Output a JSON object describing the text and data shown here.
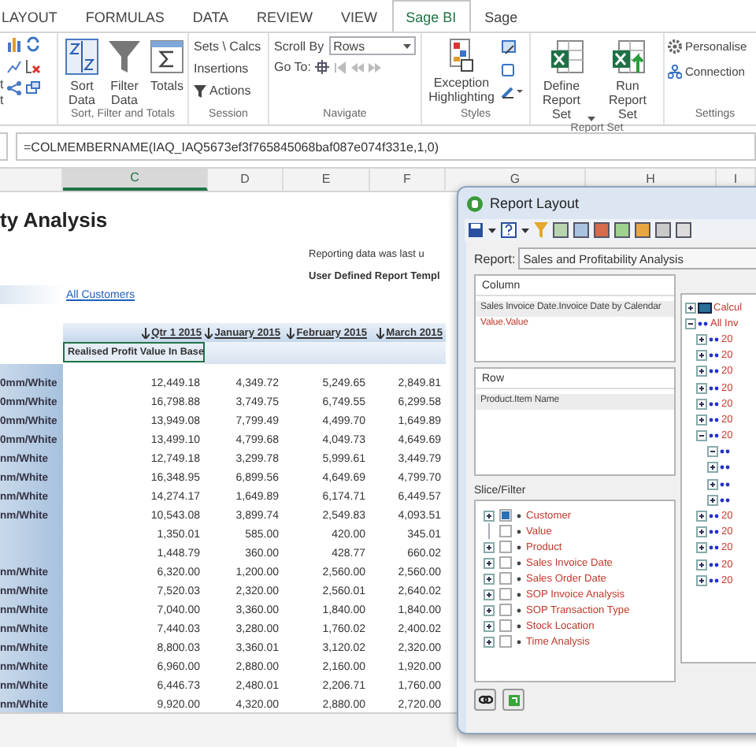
{
  "ribbon_tabs": [
    {
      "label": "LAYOUT",
      "selected": false
    },
    {
      "label": "FORMULAS",
      "selected": false
    },
    {
      "label": "DATA",
      "selected": false
    },
    {
      "label": "REVIEW",
      "selected": false
    },
    {
      "label": "VIEW",
      "selected": false
    },
    {
      "label": "Sage BI",
      "selected": true
    },
    {
      "label": "Sage",
      "selected": false
    }
  ],
  "ribbon": {
    "partial_group": {
      "labels": [
        "t",
        "t"
      ]
    },
    "sort_group": {
      "label": "Sort, Filter and Totals",
      "buttons": [
        {
          "kind": "sort",
          "label": "Sort Data"
        },
        {
          "kind": "filter",
          "label": "Filter Data"
        },
        {
          "kind": "totals",
          "label": "Totals"
        }
      ]
    },
    "session_group": {
      "label": "Session",
      "items": [
        {
          "kind": "text",
          "label": "Sets \\ Calcs"
        },
        {
          "kind": "text",
          "label": "Insertions"
        },
        {
          "kind": "funnel",
          "label": "Actions"
        }
      ]
    },
    "navigate_group": {
      "label": "Navigate",
      "scroll_by_label": "Scroll By",
      "scroll_by_value": "Rows",
      "go_to_label": "Go To:"
    },
    "styles_group": {
      "label": "Styles",
      "button": "Exception Highlighting"
    },
    "report_set_group": {
      "label": "Report Set",
      "buttons": [
        {
          "kind": "define",
          "label": "Define Report Set",
          "dropdown": true
        },
        {
          "kind": "run",
          "label": "Run Report Set",
          "dropdown": false
        }
      ]
    },
    "settings_group": {
      "label": "Settings",
      "items": [
        {
          "kind": "gear",
          "label": "Personalise"
        },
        {
          "kind": "network",
          "label": "Connection"
        }
      ]
    }
  },
  "formula_bar": {
    "formula": "=COLMEMBERNAME(IAQ_IAQ5673ef3f765845068baf087e074f331e,1,0)"
  },
  "sheet": {
    "columns": [
      {
        "label": "C",
        "selected": true
      },
      {
        "label": "D",
        "selected": false
      },
      {
        "label": "E",
        "selected": false
      },
      {
        "label": "F",
        "selected": false
      },
      {
        "label": "G",
        "selected": false
      },
      {
        "label": "H",
        "selected": false
      },
      {
        "label": "I",
        "selected": false
      }
    ],
    "title": "ty Analysis",
    "reporting_note": "Reporting data was last u",
    "template_note": "User Defined Report Templ",
    "customer_link": "All Customers",
    "period_headers": [
      "Qtr 1 2015",
      "January 2015",
      "February 2015",
      "March 2015"
    ],
    "measure": "Realised Profit Value In Base",
    "rows": [
      {
        "label": "0mm/White",
        "values": [
          "12,449.18",
          "4,349.72",
          "5,249.65",
          "2,849.81"
        ]
      },
      {
        "label": "0mm/White",
        "values": [
          "16,798.88",
          "3,749.75",
          "6,749.55",
          "6,299.58"
        ]
      },
      {
        "label": "0mm/White",
        "values": [
          "13,949.08",
          "7,799.49",
          "4,499.70",
          "1,649.89"
        ]
      },
      {
        "label": "0mm/White",
        "values": [
          "13,499.10",
          "4,799.68",
          "4,049.73",
          "4,649.69"
        ]
      },
      {
        "label": "nm/White",
        "values": [
          "12,749.18",
          "3,299.78",
          "5,999.61",
          "3,449.79"
        ]
      },
      {
        "label": "nm/White",
        "values": [
          "16,348.95",
          "6,899.56",
          "4,649.69",
          "4,799.70"
        ]
      },
      {
        "label": "nm/White",
        "values": [
          "14,274.17",
          "1,649.89",
          "6,174.71",
          "6,449.57"
        ]
      },
      {
        "label": "nm/White",
        "values": [
          "10,543.08",
          "3,899.74",
          "2,549.83",
          "4,093.51"
        ]
      },
      {
        "values": [
          "1,350.01",
          "585.00",
          "420.00",
          "345.01"
        ]
      },
      {
        "values": [
          "1,448.79",
          "360.00",
          "428.77",
          "660.02"
        ]
      },
      {
        "label": "nm/White",
        "values": [
          "6,320.00",
          "1,200.00",
          "2,560.00",
          "2,560.00"
        ]
      },
      {
        "label": "nm/White",
        "values": [
          "7,520.03",
          "2,320.00",
          "2,560.01",
          "2,640.02"
        ]
      },
      {
        "label": "nm/White",
        "values": [
          "7,040.00",
          "3,360.00",
          "1,840.00",
          "1,840.00"
        ]
      },
      {
        "label": "nm/White",
        "values": [
          "7,440.03",
          "3,280.00",
          "1,760.02",
          "2,400.02"
        ]
      },
      {
        "label": "nm/White",
        "values": [
          "8,800.03",
          "3,360.01",
          "3,120.02",
          "2,320.00"
        ]
      },
      {
        "label": "nm/White",
        "values": [
          "6,960.00",
          "2,880.00",
          "2,160.00",
          "1,920.00"
        ]
      },
      {
        "label": "nm/White",
        "values": [
          "6,446.73",
          "2,480.01",
          "2,206.71",
          "1,760.00"
        ]
      },
      {
        "label": "nm/White",
        "values": [
          "9,920.00",
          "4,320.00",
          "2,880.00",
          "2,720.00"
        ]
      }
    ]
  },
  "dialog": {
    "title": "Report Layout",
    "report_label": "Report:",
    "report_value": "Sales and Profitability Analysis",
    "column_panel": {
      "title": "Column",
      "items": [
        {
          "label": "Sales Invoice Date.Invoice Date by Calendar",
          "kind": "dimension"
        },
        {
          "label": "Value.Value",
          "kind": "measure"
        }
      ]
    },
    "row_panel": {
      "title": "Row",
      "items": [
        {
          "label": "Product.Item Name",
          "kind": "dimension"
        }
      ]
    },
    "slice_filter": {
      "title": "Slice/Filter",
      "items": [
        {
          "label": "Customer",
          "checked": true,
          "expandable": true
        },
        {
          "label": "Value",
          "checked": false,
          "expandable": false
        },
        {
          "label": "Product",
          "checked": false,
          "expandable": true
        },
        {
          "label": "Sales Invoice Date",
          "checked": false,
          "expandable": true
        },
        {
          "label": "Sales Order Date",
          "checked": false,
          "expandable": true
        },
        {
          "label": "SOP Invoice Analysis",
          "checked": false,
          "expandable": true
        },
        {
          "label": "SOP Transaction Type",
          "checked": false,
          "expandable": true
        },
        {
          "label": "Stock Location",
          "checked": false,
          "expandable": true
        },
        {
          "label": "Time Analysis",
          "checked": false,
          "expandable": true
        }
      ]
    },
    "tree": [
      {
        "label": "Calcul",
        "kind": "calculation",
        "expanded": false
      },
      {
        "label": "All Inv",
        "kind": "member",
        "expanded": true,
        "children": [
          {
            "label": "20",
            "kind": "member",
            "expanded": false
          },
          {
            "label": "20",
            "kind": "member",
            "expanded": false
          },
          {
            "label": "20",
            "kind": "member",
            "expanded": false
          },
          {
            "label": "20",
            "kind": "member",
            "expanded": false
          },
          {
            "label": "20",
            "kind": "member",
            "expanded": false
          },
          {
            "label": "20",
            "kind": "member",
            "expanded": false
          },
          {
            "label": "20",
            "kind": "member",
            "expanded": true,
            "children": [
              {
                "kind": "member",
                "expanded": true
              },
              {
                "kind": "member",
                "expanded": false
              },
              {
                "kind": "member",
                "expanded": false
              },
              {
                "kind": "member",
                "expanded": false
              }
            ]
          },
          {
            "label": "20",
            "kind": "member",
            "expanded": false
          },
          {
            "label": "20",
            "kind": "member",
            "expanded": false
          },
          {
            "label": "20",
            "kind": "member",
            "expanded": false
          },
          {
            "label": "20",
            "kind": "member",
            "expanded": false
          },
          {
            "label": "20",
            "kind": "member",
            "expanded": false
          }
        ]
      }
    ]
  }
}
